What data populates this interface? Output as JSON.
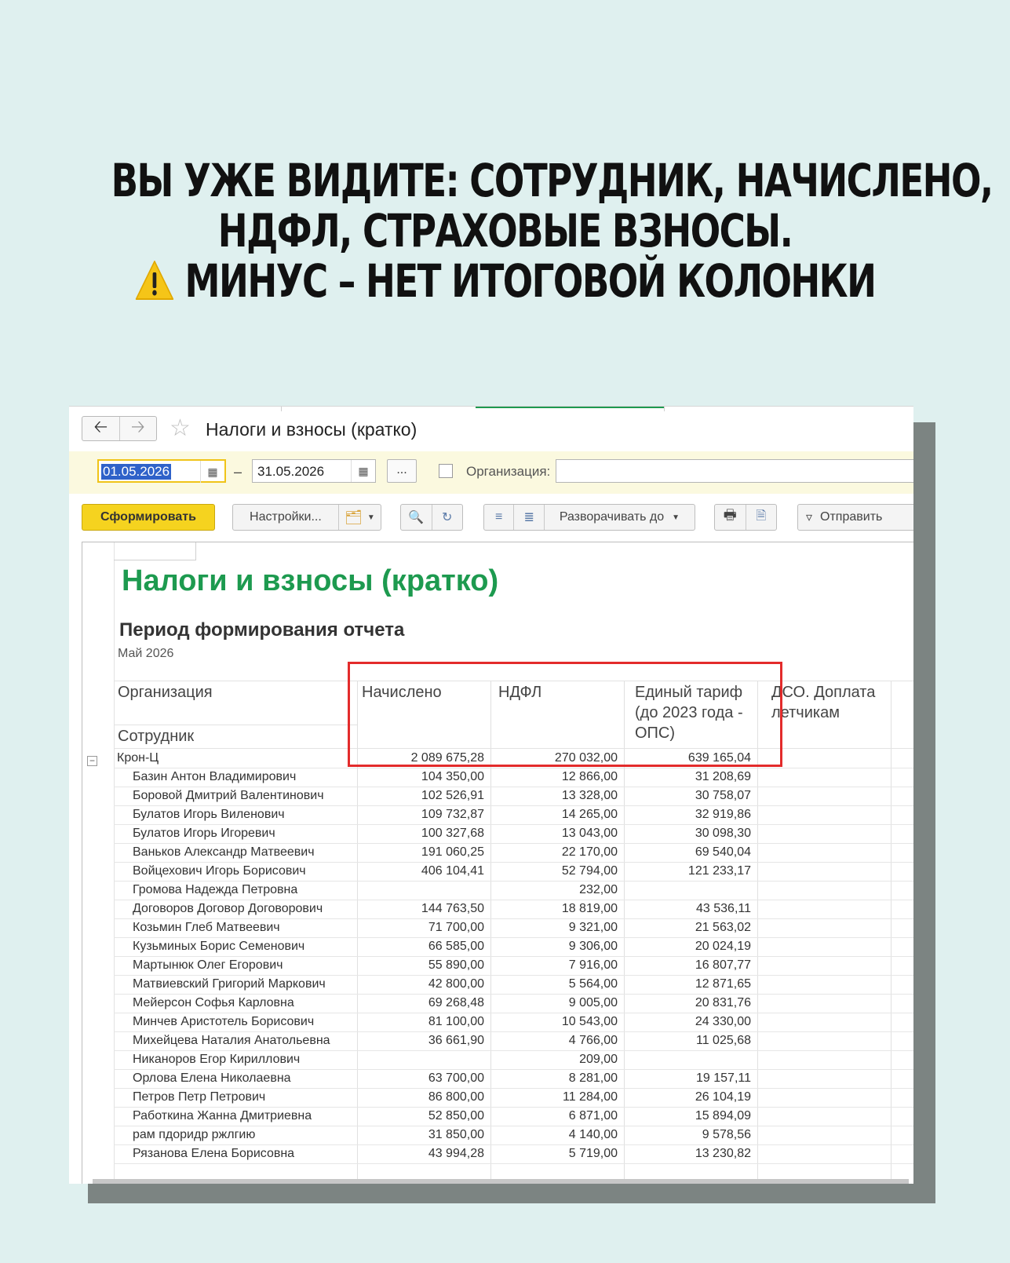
{
  "headline": {
    "line1": "ВЫ УЖЕ ВИДИТЕ: СОТРУДНИК, НАЧИСЛЕНО,",
    "line2": "НДФЛ, СТРАХОВЫЕ ВЗНОСЫ.",
    "line3": "МИНУС – НЕТ ИТОГОВОЙ КОЛОНКИ",
    "icon": "warning-icon"
  },
  "colors": {
    "background": "#dff0ef",
    "report_title": "#1d9a4f",
    "primary_button": "#f5d31f",
    "highlight_box": "#e32b2b",
    "filter_bar": "#fbf9df"
  },
  "window": {
    "title": "Налоги и взносы (кратко)",
    "back_icon": "arrow-left-icon",
    "forward_icon": "arrow-right-icon",
    "favorite_icon": "star-icon"
  },
  "filters": {
    "date_from": "01.05.2026",
    "date_separator": "–",
    "date_to": "31.05.2026",
    "period_button": "...",
    "organization_label": "Организация:",
    "organization_value": ""
  },
  "toolbar": {
    "generate": "Сформировать",
    "settings": "Настройки...",
    "expand_to": "Разворачивать до",
    "send": "Отправить"
  },
  "report": {
    "title": "Налоги и взносы (кратко)",
    "period_label": "Период формирования отчета",
    "period_value": "Май 2026",
    "headers": {
      "organization": "Организация",
      "employee": "Сотрудник",
      "accrued": "Начислено",
      "ndfl": "НДФЛ",
      "tariff_l1": "Единый тариф",
      "tariff_l2": "(до 2023 года -",
      "tariff_l3": "ОПС)",
      "dso_l1": "ДСО. Доплата",
      "dso_l2": "летчикам"
    },
    "group": {
      "name": "Крон-Ц",
      "accrued": "2 089 675,28",
      "ndfl": "270 032,00",
      "tariff": "639 165,04"
    },
    "rows": [
      {
        "name": "Базин Антон Владимирович",
        "accrued": "104 350,00",
        "ndfl": "12 866,00",
        "tariff": "31 208,69"
      },
      {
        "name": "Боровой Дмитрий Валентинович",
        "accrued": "102 526,91",
        "ndfl": "13 328,00",
        "tariff": "30 758,07"
      },
      {
        "name": "Булатов Игорь Виленович",
        "accrued": "109 732,87",
        "ndfl": "14 265,00",
        "tariff": "32 919,86"
      },
      {
        "name": "Булатов Игорь Игоревич",
        "accrued": "100 327,68",
        "ndfl": "13 043,00",
        "tariff": "30 098,30"
      },
      {
        "name": "Ваньков Александр Матвеевич",
        "accrued": "191 060,25",
        "ndfl": "22 170,00",
        "tariff": "69 540,04"
      },
      {
        "name": "Войцехович Игорь Борисович",
        "accrued": "406 104,41",
        "ndfl": "52 794,00",
        "tariff": "121 233,17"
      },
      {
        "name": "Громова Надежда Петровна",
        "accrued": "",
        "ndfl": "232,00",
        "tariff": ""
      },
      {
        "name": "Договоров Договор Договорович",
        "accrued": "144 763,50",
        "ndfl": "18 819,00",
        "tariff": "43 536,11"
      },
      {
        "name": "Козьмин Глеб Матвеевич",
        "accrued": "71 700,00",
        "ndfl": "9 321,00",
        "tariff": "21 563,02"
      },
      {
        "name": "Кузьминых Борис Семенович",
        "accrued": "66 585,00",
        "ndfl": "9 306,00",
        "tariff": "20 024,19"
      },
      {
        "name": "Мартынюк Олег Егорович",
        "accrued": "55 890,00",
        "ndfl": "7 916,00",
        "tariff": "16 807,77"
      },
      {
        "name": "Матвиевский Григорий Маркович",
        "accrued": "42 800,00",
        "ndfl": "5 564,00",
        "tariff": "12 871,65"
      },
      {
        "name": "Мейерсон Софья Карловна",
        "accrued": "69 268,48",
        "ndfl": "9 005,00",
        "tariff": "20 831,76"
      },
      {
        "name": "Минчев Аристотель Борисович",
        "accrued": "81 100,00",
        "ndfl": "10 543,00",
        "tariff": "24 330,00"
      },
      {
        "name": "Михейцева Наталия Анатольевна",
        "accrued": "36 661,90",
        "ndfl": "4 766,00",
        "tariff": "11 025,68"
      },
      {
        "name": "Никаноров Егор Кириллович",
        "accrued": "",
        "ndfl": "209,00",
        "tariff": ""
      },
      {
        "name": "Орлова Елена Николаевна",
        "accrued": "63 700,00",
        "ndfl": "8 281,00",
        "tariff": "19 157,11"
      },
      {
        "name": "Петров Петр Петрович",
        "accrued": "86 800,00",
        "ndfl": "11 284,00",
        "tariff": "26 104,19"
      },
      {
        "name": "Работкина Жанна Дмитриевна",
        "accrued": "52 850,00",
        "ndfl": "6 871,00",
        "tariff": "15 894,09"
      },
      {
        "name": "рам пдоридр ржлгию",
        "accrued": "31 850,00",
        "ndfl": "4 140,00",
        "tariff": "9 578,56"
      },
      {
        "name": "Рязанова Елена Борисовна",
        "accrued": "43 994,28",
        "ndfl": "5 719,00",
        "tariff": "13 230,82"
      }
    ]
  }
}
